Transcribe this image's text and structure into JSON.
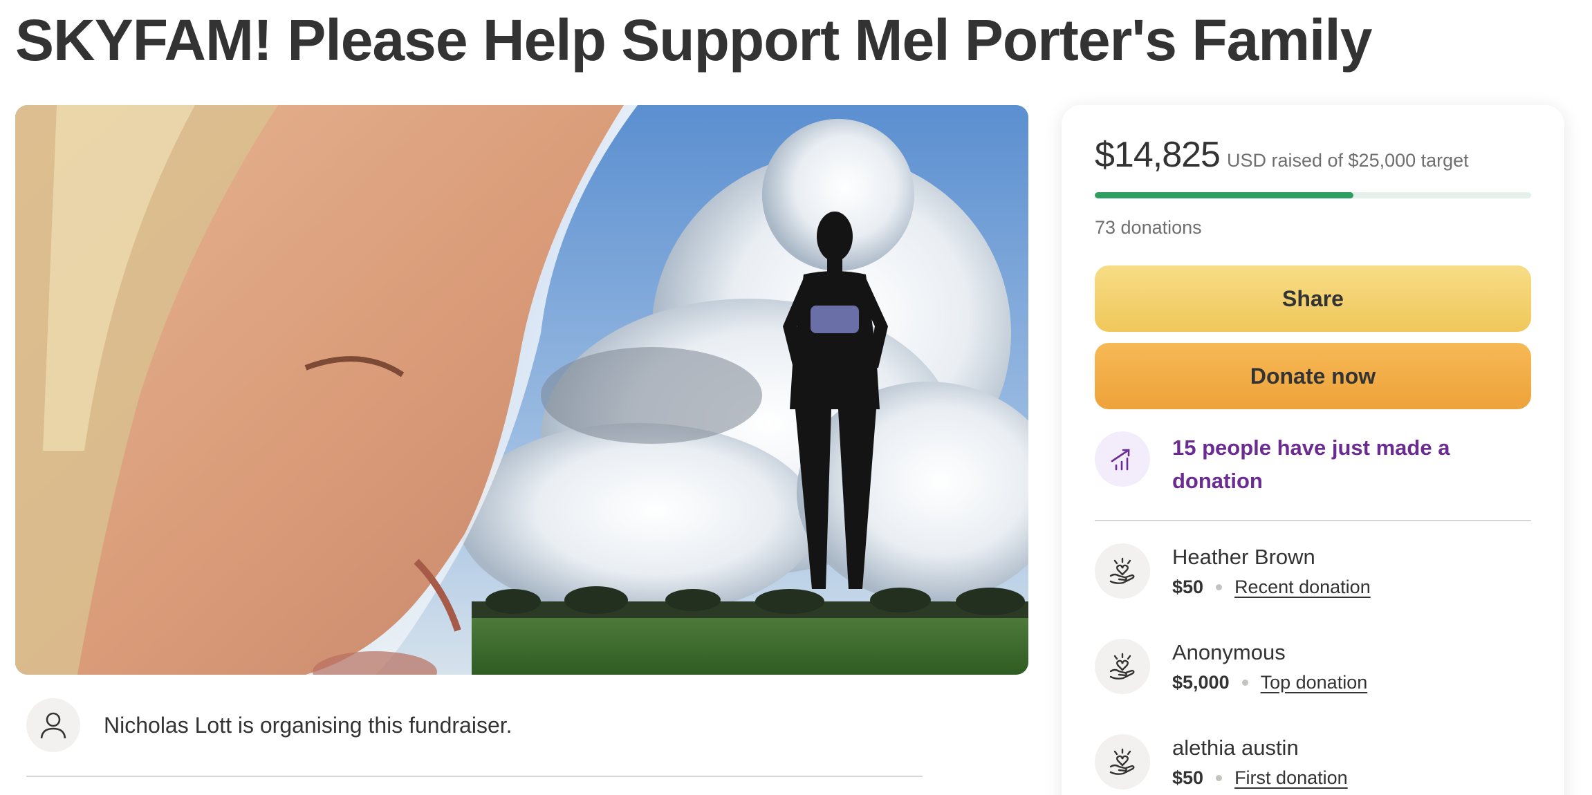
{
  "page": {
    "title": "SKYFAM! Please Help Support Mel Porter's Family"
  },
  "organiser": {
    "text": "Nicholas Lott is organising this fundraiser.",
    "icon": "person-icon"
  },
  "donation_card": {
    "raised_amount": "$14,825",
    "raised_text": "USD raised of $25,000 target",
    "progress_fraction": 0.593,
    "donation_count": "73 donations",
    "share_label": "Share",
    "donate_label": "Donate now",
    "trend_text": "15 people have just made a donation",
    "trend_icon": "trending-up-icon",
    "donors": [
      {
        "name": "Heather Brown",
        "amount": "$50",
        "label": "Recent donation",
        "icon": "heart-hand-icon"
      },
      {
        "name": "Anonymous",
        "amount": "$5,000",
        "label": "Top donation",
        "icon": "heart-hand-icon"
      },
      {
        "name": "alethia austin",
        "amount": "$50",
        "label": "First donation",
        "icon": "heart-hand-icon"
      }
    ]
  },
  "colors": {
    "progress": "#2f9e61",
    "share_button": "#f3d16f",
    "donate_button": "#f1ab44",
    "trend_text": "#6a2c91"
  }
}
